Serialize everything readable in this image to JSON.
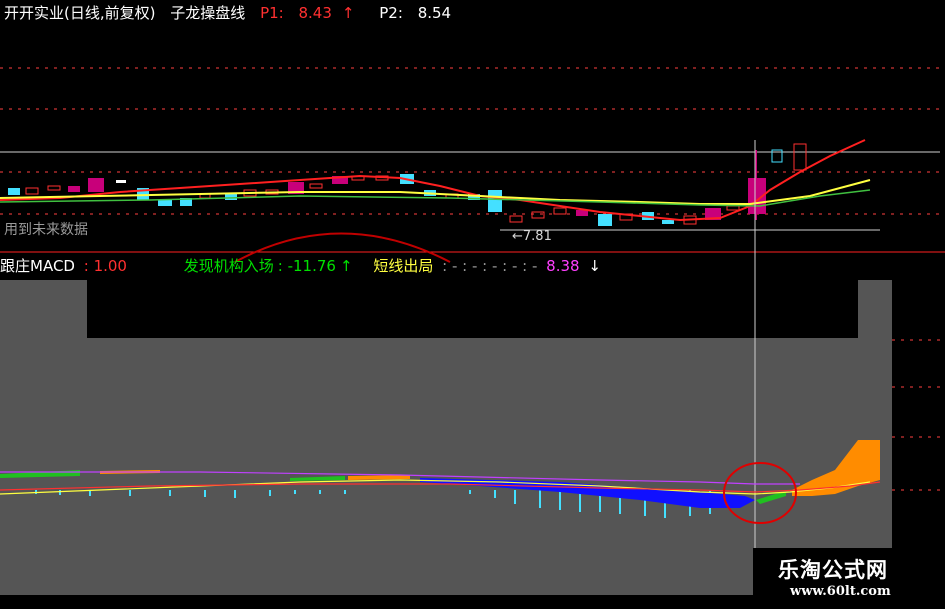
{
  "header": {
    "stock": "开开实业(日线,前复权)",
    "indicator": "子龙操盘线",
    "p1_label": "P1:",
    "p1_value": "8.43",
    "p1_arrow": "↑",
    "p2_label": "P2:",
    "p2_value": "8.54"
  },
  "price_panel": {
    "low_marker": "←7.81",
    "future_note": "用到未来数据"
  },
  "indicator_row": {
    "name": "跟庄MACD",
    "value1": ": 1.00",
    "signal_label": "发现机构入场",
    "signal_value": ": -11.76",
    "signal_arrow": "↑",
    "exit_label": "短线出局",
    "exit_value": ": - : - : - : - : -",
    "last_value": "8.38",
    "last_arrow": "↓"
  },
  "watermark": {
    "title": "乐淘公式网",
    "url": "www.60lt.com"
  },
  "colors": {
    "background": "#000000",
    "panel_gray": "#555555",
    "up_candle": "#c8007a",
    "down_candle": "#44e0ff",
    "ma_red": "#ff2020",
    "ma_yellow": "#ffff40",
    "macd_blue": "#1010ff",
    "macd_orange": "#ff8c00",
    "macd_green": "#20c020",
    "circle": "#e00000"
  }
}
